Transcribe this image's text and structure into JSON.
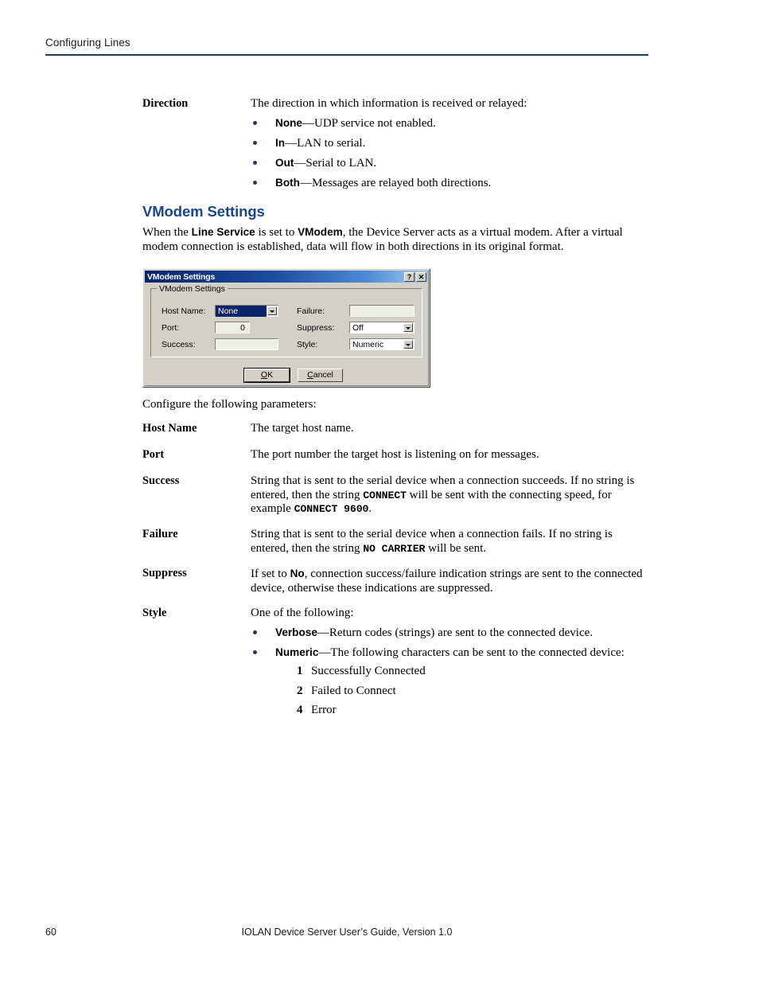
{
  "header": {
    "running_head": "Configuring Lines",
    "rule_color": "#1f3864"
  },
  "direction_section": {
    "term": "Direction",
    "intro": "The direction in which information is received or relayed:",
    "bullets": [
      {
        "bold": "None",
        "rest": "—UDP service not enabled."
      },
      {
        "bold": "In",
        "rest": "—LAN to serial."
      },
      {
        "bold": "Out",
        "rest": "—Serial to LAN."
      },
      {
        "bold": "Both",
        "rest": "—Messages are relayed both directions."
      }
    ],
    "bullet_color": "#1f3864"
  },
  "vmodem_section": {
    "heading": "VModem Settings",
    "heading_color": "#17468f",
    "intro_1": "When the ",
    "intro_b1": "Line Service",
    "intro_2": " is set to ",
    "intro_b2": "VModem",
    "intro_3": ", the Device Server acts as a virtual modem. After a virtual modem connection is established, data will flow in both directions in its original format.",
    "configure_line": "Configure the following parameters:"
  },
  "dialog": {
    "title": "VModem Settings",
    "help_button": "?",
    "close_button": "✕",
    "groupbox_legend": "VModem Settings",
    "fields": {
      "host_name_label": "Host Name:",
      "host_name_value": "None",
      "port_label": "Port:",
      "port_value": "0",
      "success_label": "Success:",
      "success_value": "",
      "failure_label": "Failure:",
      "failure_value": "",
      "suppress_label": "Suppress:",
      "suppress_value": "Off",
      "style_label": "Style:",
      "style_value": "Numeric"
    },
    "buttons": {
      "ok_mnemonic": "O",
      "ok_rest": "K",
      "cancel_mnemonic": "C",
      "cancel_rest": "ancel"
    }
  },
  "parameters": [
    {
      "term": "Host Name",
      "text": "The target host name."
    },
    {
      "term": "Port",
      "text": "The port number the target host is listening on for messages."
    },
    {
      "term": "Success",
      "text_1": "String that is sent to the serial device when a connection succeeds. If no string is entered, then the string ",
      "mono_1": "CONNECT",
      "text_2": " will be sent with the connecting speed, for example ",
      "mono_2": "CONNECT 9600",
      "text_3": "."
    },
    {
      "term": "Failure",
      "text_1": "String that is sent to the serial device when a connection fails. If no string is entered, then the string ",
      "mono_1": "NO CARRIER",
      "text_2": " will be sent."
    },
    {
      "term": "Suppress",
      "text_1": "If set to ",
      "bold_1": "No",
      "text_2": ", connection success/failure indication strings are sent to the connected device, otherwise these indications are suppressed."
    },
    {
      "term": "Style",
      "intro": "One of the following:",
      "bullets": [
        {
          "bold": "Verbose",
          "rest": "—Return codes (strings) are sent to the connected device."
        },
        {
          "bold": "Numeric",
          "rest": "—The following characters can be sent to the connected device:"
        }
      ],
      "numbered": [
        {
          "num": "1",
          "text": "Successfully Connected"
        },
        {
          "num": "2",
          "text": "Failed to Connect"
        },
        {
          "num": "4",
          "text": "Error"
        }
      ]
    }
  ],
  "footer": {
    "page_number": "60",
    "center_text": "IOLAN Device Server User’s Guide, Version 1.0"
  }
}
